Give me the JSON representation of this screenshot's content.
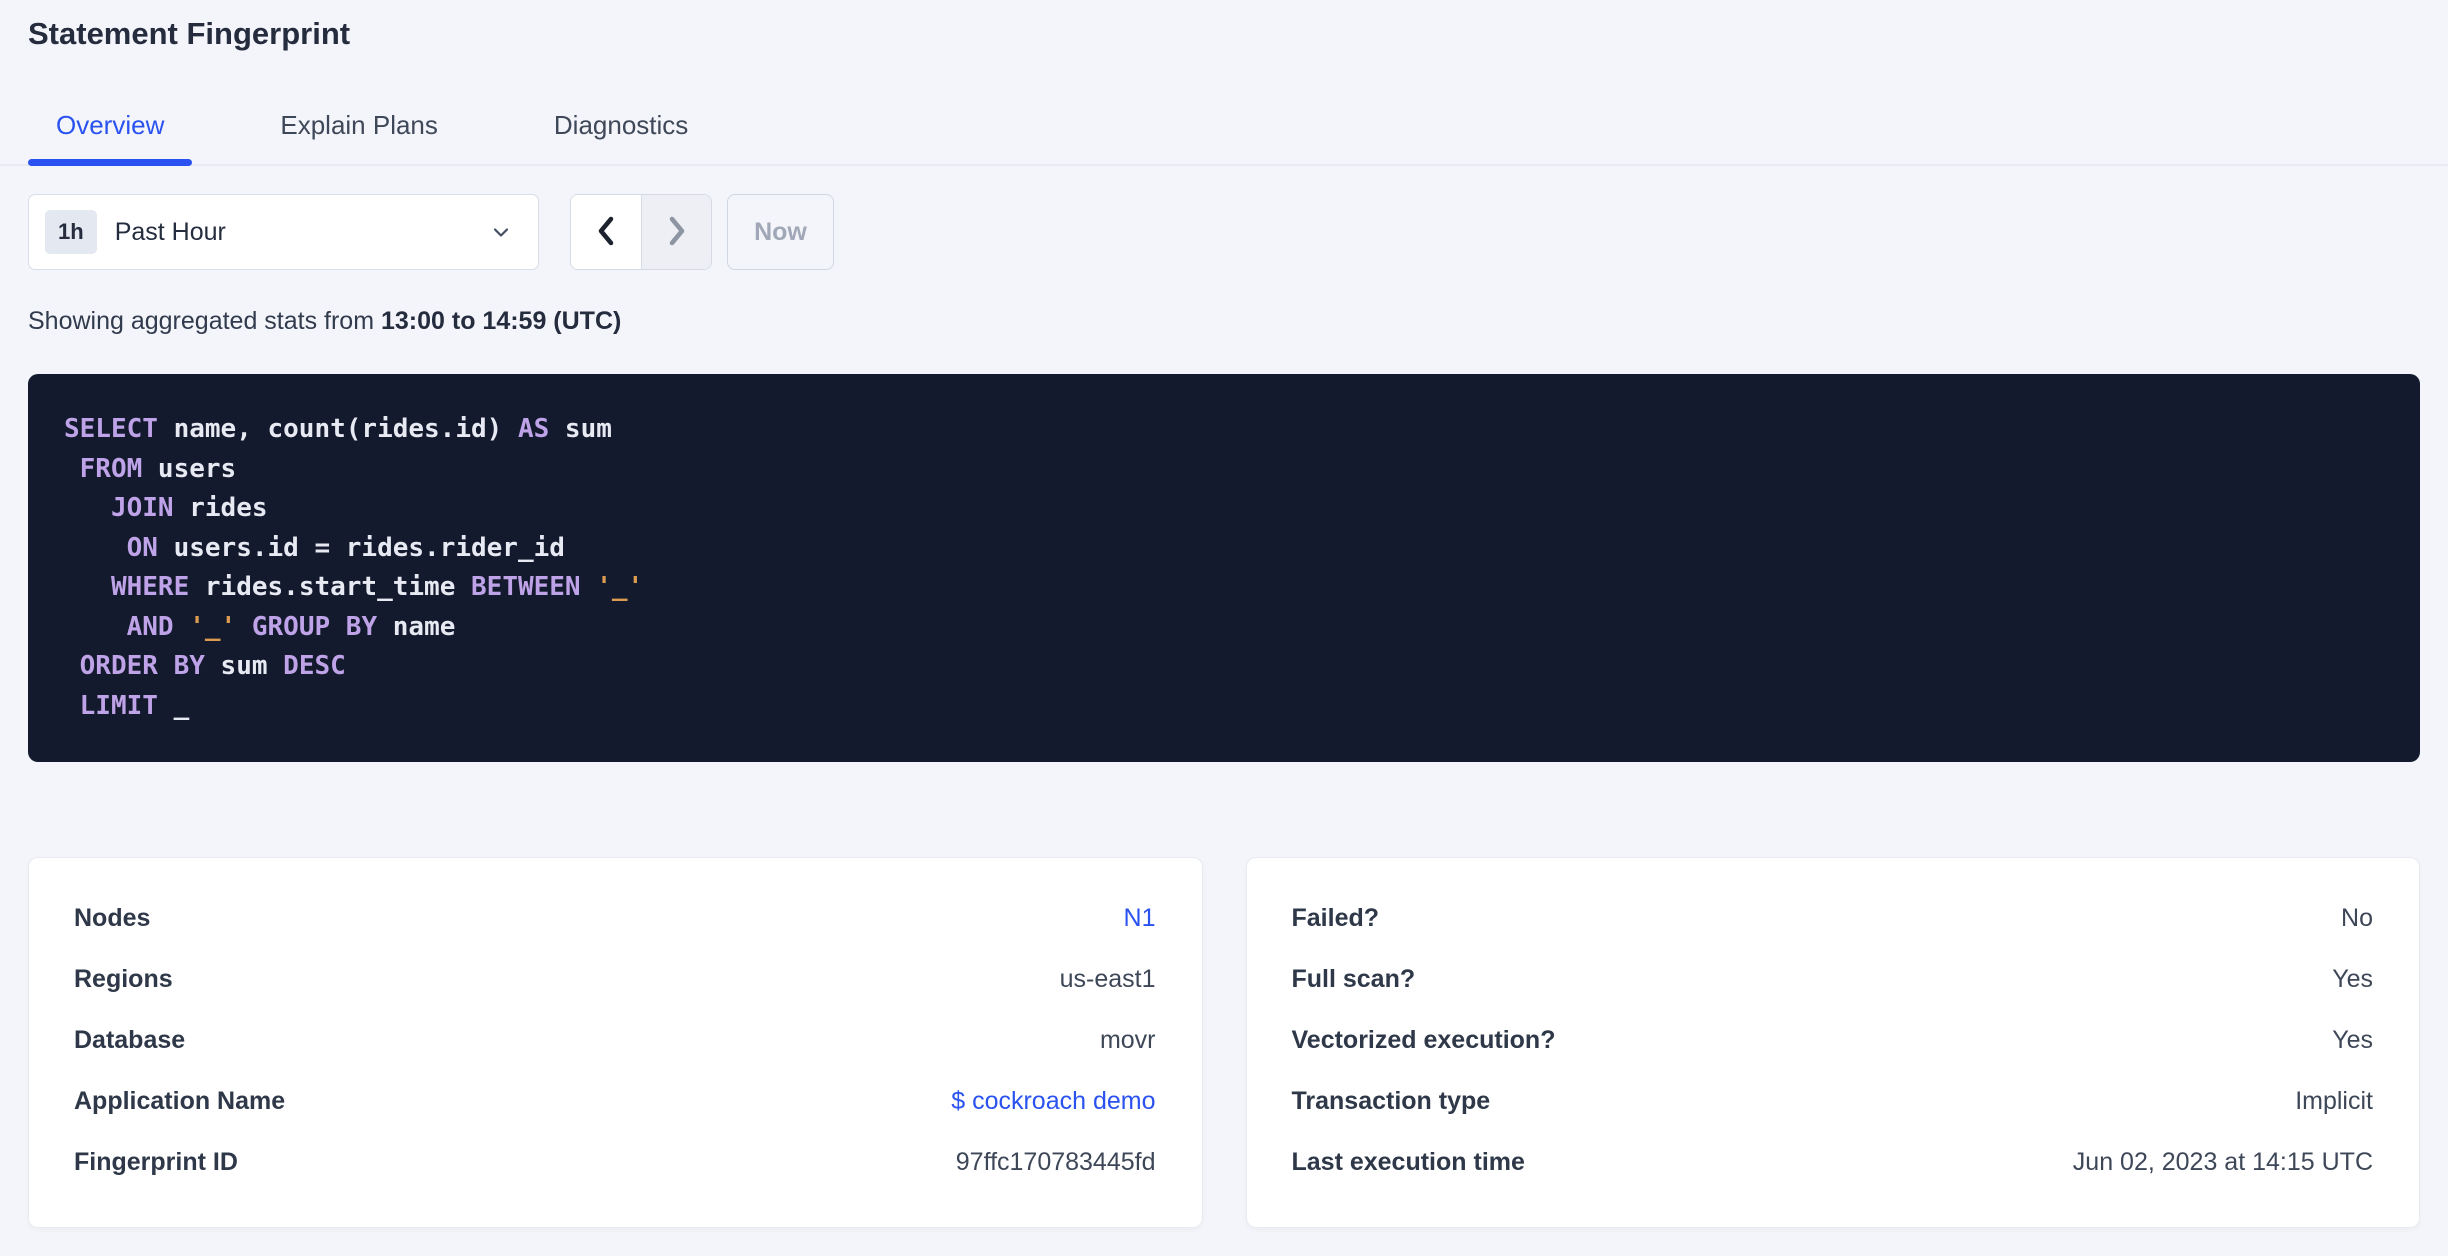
{
  "page": {
    "title": "Statement Fingerprint"
  },
  "tabs": [
    {
      "id": "overview",
      "label": "Overview",
      "active": true
    },
    {
      "id": "explain-plans",
      "label": "Explain Plans",
      "active": false
    },
    {
      "id": "diagnostics",
      "label": "Diagnostics",
      "active": false
    }
  ],
  "time_picker": {
    "badge": "1h",
    "label": "Past Hour",
    "now_label": "Now"
  },
  "stats_line": {
    "prefix": "Showing aggregated stats from ",
    "range": "13:00 to 14:59 (UTC)"
  },
  "sql": {
    "lines": [
      [
        [
          "kw",
          "SELECT"
        ],
        [
          "pl",
          " name, count(rides.id) "
        ],
        [
          "kw",
          "AS"
        ],
        [
          "pl",
          " sum"
        ]
      ],
      [
        [
          "pl",
          " "
        ],
        [
          "kw",
          "FROM"
        ],
        [
          "pl",
          " users"
        ]
      ],
      [
        [
          "pl",
          "   "
        ],
        [
          "kw",
          "JOIN"
        ],
        [
          "pl",
          " rides"
        ]
      ],
      [
        [
          "pl",
          "    "
        ],
        [
          "kw",
          "ON"
        ],
        [
          "pl",
          " users.id = rides.rider_id"
        ]
      ],
      [
        [
          "pl",
          "   "
        ],
        [
          "kw",
          "WHERE"
        ],
        [
          "pl",
          " rides.start_time "
        ],
        [
          "kw",
          "BETWEEN"
        ],
        [
          "pl",
          " "
        ],
        [
          "str",
          "'_'"
        ]
      ],
      [
        [
          "pl",
          "    "
        ],
        [
          "kw",
          "AND"
        ],
        [
          "pl",
          " "
        ],
        [
          "str",
          "'_'"
        ],
        [
          "pl",
          " "
        ],
        [
          "kw",
          "GROUP BY"
        ],
        [
          "pl",
          " name"
        ]
      ],
      [
        [
          "pl",
          " "
        ],
        [
          "kw",
          "ORDER BY"
        ],
        [
          "pl",
          " sum "
        ],
        [
          "kw",
          "DESC"
        ]
      ],
      [
        [
          "pl",
          " "
        ],
        [
          "kw",
          "LIMIT"
        ],
        [
          "pl",
          " _"
        ]
      ]
    ]
  },
  "cards": {
    "left": {
      "rows": [
        {
          "label": "Nodes",
          "value": "N1",
          "link": true
        },
        {
          "label": "Regions",
          "value": "us-east1",
          "link": false
        },
        {
          "label": "Database",
          "value": "movr",
          "link": false
        },
        {
          "label": "Application Name",
          "value": "$ cockroach demo",
          "link": true
        },
        {
          "label": "Fingerprint ID",
          "value": "97ffc170783445fd",
          "link": false
        }
      ]
    },
    "right": {
      "rows": [
        {
          "label": "Failed?",
          "value": "No",
          "link": false
        },
        {
          "label": "Full scan?",
          "value": "Yes",
          "link": false
        },
        {
          "label": "Vectorized execution?",
          "value": "Yes",
          "link": false
        },
        {
          "label": "Transaction type",
          "value": "Implicit",
          "link": false
        },
        {
          "label": "Last execution time",
          "value": "Jun 02, 2023 at 14:15 UTC",
          "link": false
        }
      ]
    }
  },
  "colors": {
    "accent_blue": "#2a52f0",
    "page_background": "#f4f5fa",
    "sql_background": "#141a2d",
    "sql_keyword": "#bfa3e8",
    "sql_plain": "#e8eaf3",
    "sql_string": "#dd9b52",
    "title_text": "#242c3e"
  }
}
